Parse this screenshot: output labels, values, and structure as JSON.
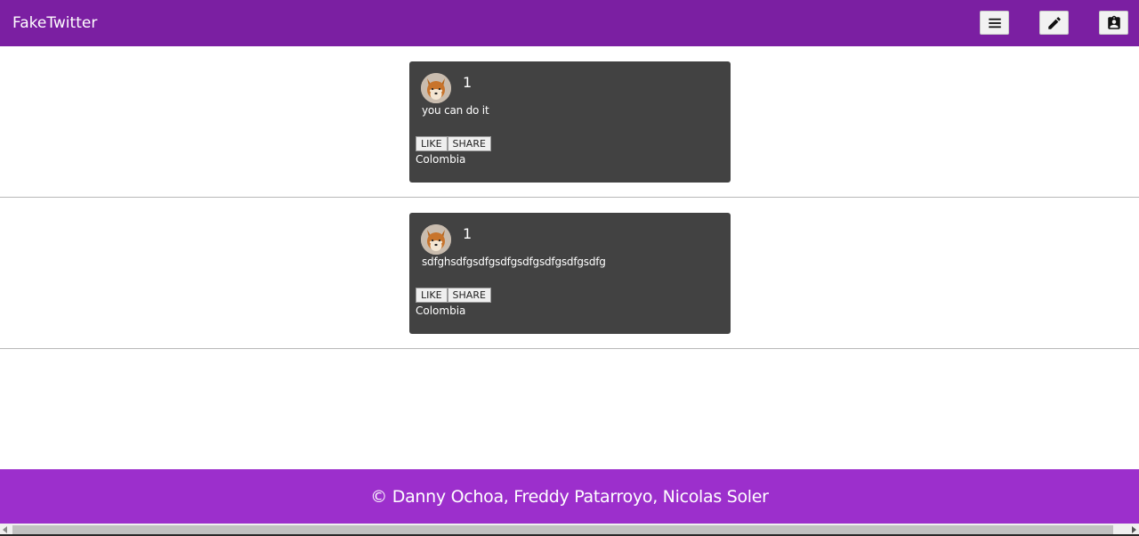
{
  "header": {
    "brand": "FakeTwitter",
    "icons": [
      "menu-icon",
      "edit-icon",
      "contact-card-icon"
    ]
  },
  "feed": {
    "posts": [
      {
        "user": "1",
        "text": "you can do it",
        "like_label": "LIKE",
        "share_label": "SHARE",
        "location": "Colombia"
      },
      {
        "user": "1",
        "text": "sdfghsdfgsdfgsdfgsdfgsdfgsdfgsdfg",
        "like_label": "LIKE",
        "share_label": "SHARE",
        "location": "Colombia"
      }
    ]
  },
  "footer": {
    "credits": "© Danny Ochoa, Freddy Patarroyo, Nicolas Soler"
  },
  "colors": {
    "appbar": "#7b1fa2",
    "footer": "#9c2fcc",
    "card": "#424242"
  }
}
